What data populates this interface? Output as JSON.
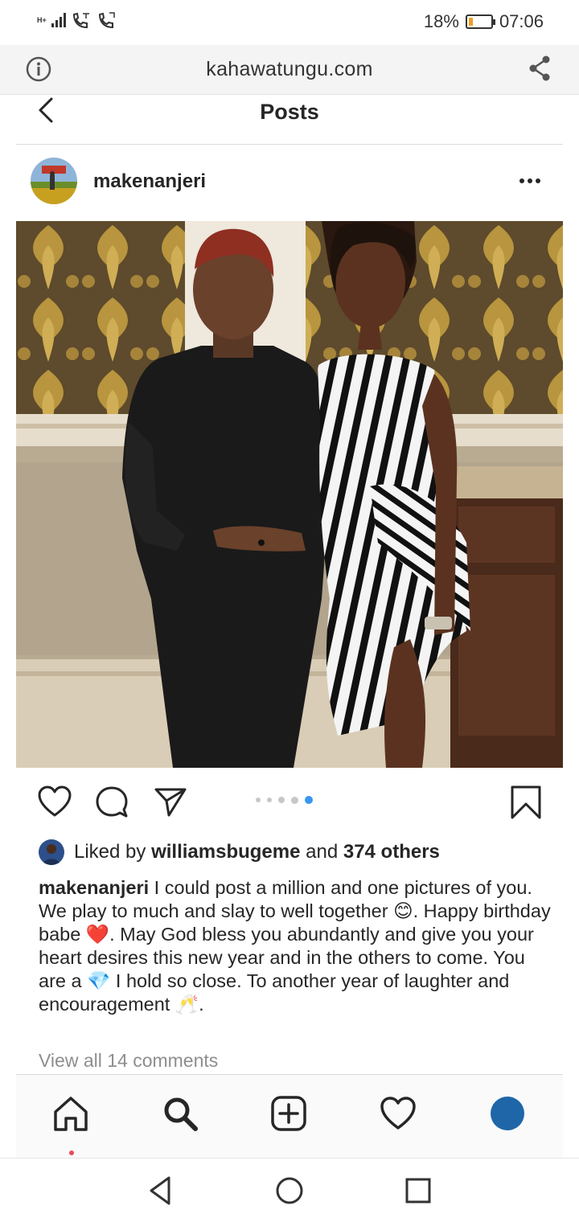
{
  "status_bar": {
    "network_label": "H+",
    "battery_percent": "18%",
    "battery_level": 0.18,
    "time": "07:06"
  },
  "browser": {
    "url": "kahawatungu.com",
    "icons": [
      "info-icon",
      "share-icon"
    ]
  },
  "instagram": {
    "header_title": "Posts",
    "post": {
      "username": "makenanjeri",
      "photo_description_icon": "photo",
      "carousel": {
        "total": 5,
        "current": 5
      },
      "likes": {
        "prefix": "Liked by ",
        "user": "williamsbugeme",
        "middle": " and ",
        "others": "374 others"
      },
      "caption": {
        "username": "makenanjeri",
        "text_1": " I could post a million and one pictures of you. We play to much and slay to well together ",
        "emoji_1": "😊",
        "text_2": ". Happy birthday babe ",
        "emoji_2": "❤️",
        "text_3": ". May God bless you abundantly and give you your heart desires this new year and in the others to come. You are a ",
        "emoji_3": "💎",
        "text_4": " I hold so close. To another year of laughter and encouragement ",
        "emoji_4": "🥂",
        "text_5": "."
      },
      "view_comments": "View all 14 comments"
    },
    "tabs": [
      "home-icon",
      "search-icon",
      "add-post-icon",
      "activity-heart-icon",
      "profile-avatar"
    ]
  },
  "colors": {
    "accent_blue": "#3897f0",
    "notification_red": "#ed4956",
    "profile_blue": "#1e66a8",
    "battery_orange": "#f0a020"
  }
}
